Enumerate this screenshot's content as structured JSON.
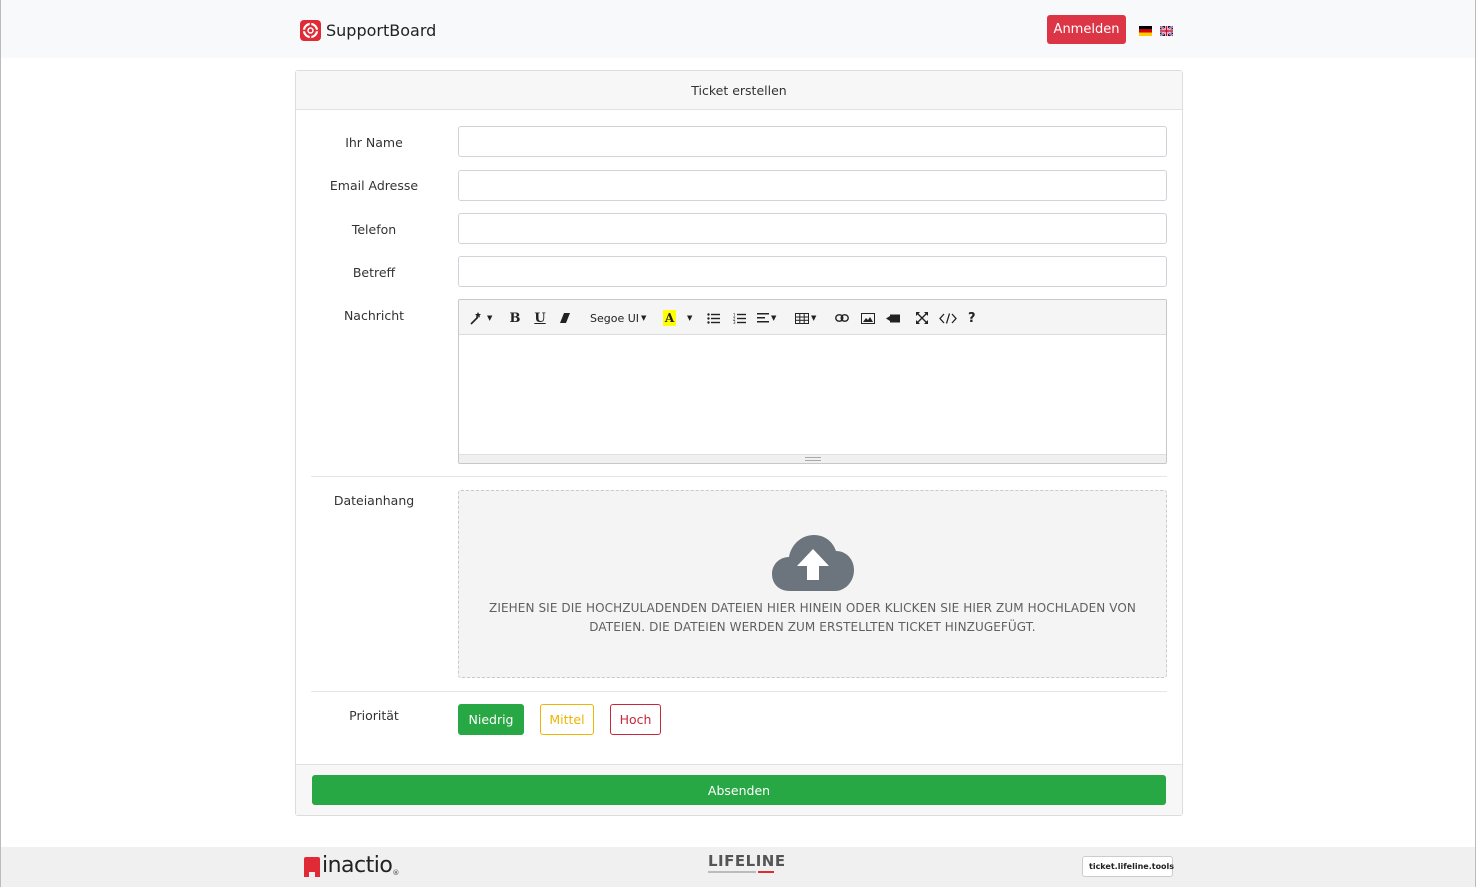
{
  "header": {
    "brand_name": "SupportBoard",
    "login_label": "Anmelden",
    "flags": [
      "de-flag-icon",
      "gb-flag-icon"
    ]
  },
  "card": {
    "title": "Ticket erstellen",
    "fields": {
      "name": {
        "label": "Ihr Name",
        "value": "",
        "placeholder": ""
      },
      "email": {
        "label": "Email Adresse",
        "value": "",
        "placeholder": ""
      },
      "phone": {
        "label": "Telefon",
        "value": "",
        "placeholder": ""
      },
      "subject": {
        "label": "Betreff",
        "value": "",
        "placeholder": ""
      }
    },
    "message": {
      "label": "Nachricht",
      "font_name": "Segoe UI",
      "content": ""
    },
    "attachment": {
      "label": "Dateianhang",
      "dropzone_text": "ZIEHEN SIE DIE HOCHZULADENDEN DATEIEN HIER HINEIN ODER KLICKEN SIE HIER ZUM HOCHLADEN VON DATEIEN. DIE DATEIEN WERDEN ZUM ERSTELLTEN TICKET HINZUGEFÜGT."
    },
    "priority": {
      "label": "Priorität",
      "options": [
        "Niedrig",
        "Mittel",
        "Hoch"
      ],
      "selected": "Niedrig"
    },
    "submit_label": "Absenden"
  },
  "footer": {
    "left_logo": "inactio",
    "center_logo": "LIFELINE",
    "right_badge": "ticket.lifeline.tools"
  },
  "colors": {
    "brand_red": "#e02b36",
    "login_red": "#dc3545",
    "success_green": "#28a745",
    "warning_yellow": "#f0b400",
    "danger_red": "#c8283a"
  }
}
